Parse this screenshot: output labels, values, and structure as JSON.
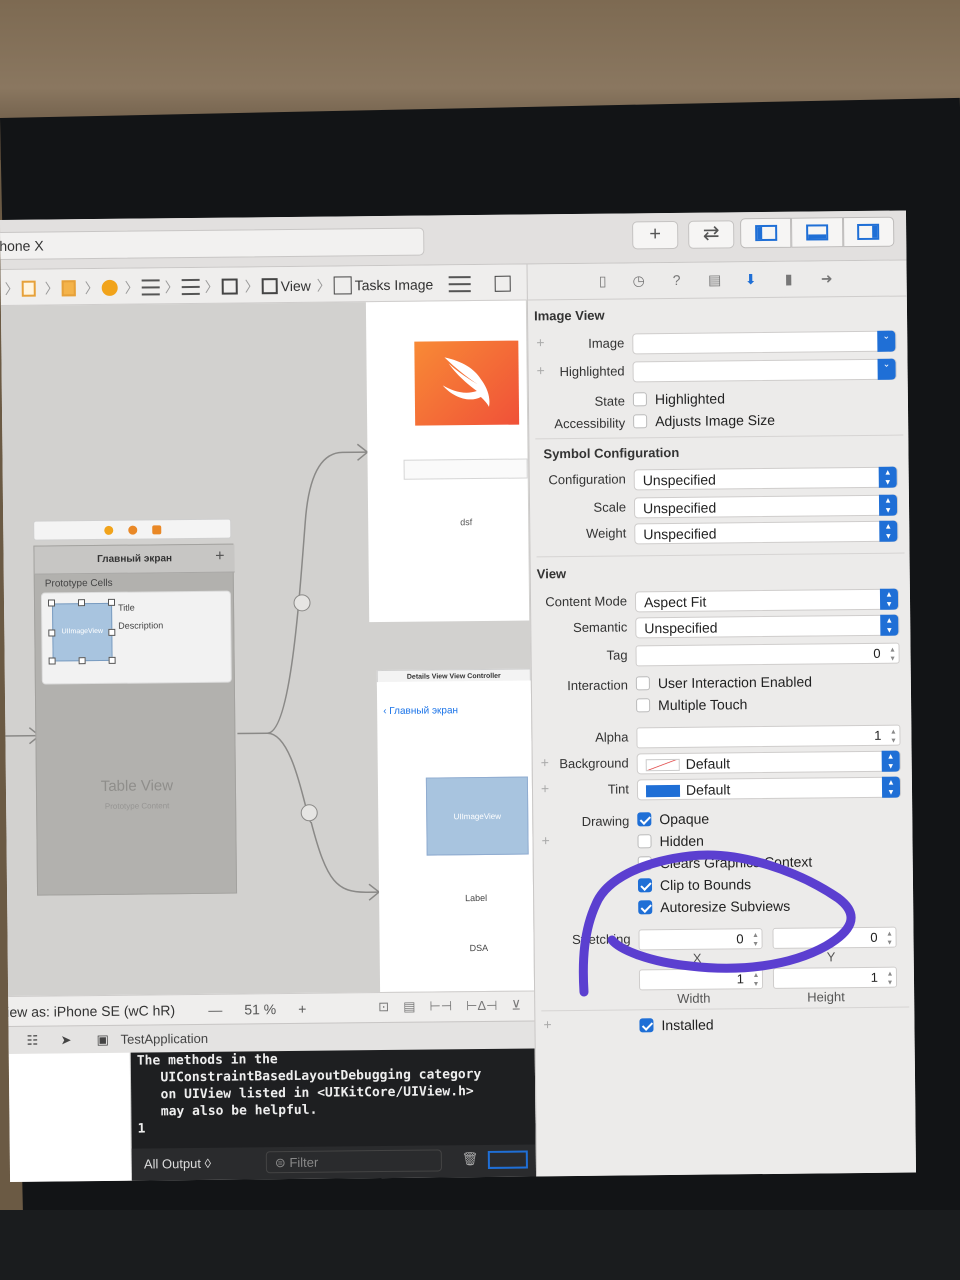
{
  "toolbar": {
    "scheme": "hone X",
    "add_label": "+",
    "swap_label": "⇄"
  },
  "jumpbar": {
    "view_label": "View",
    "tasks_image_label": "Tasks Image"
  },
  "canvas": {
    "top_vc_text": "dsf",
    "table_nav_title": "Главный экран",
    "prototype_cells": "Prototype Cells",
    "cell_image": "UIImageView",
    "cell_title": "Title",
    "cell_description": "Description",
    "table_view_title": "Table View",
    "table_view_sub": "Prototype Content",
    "detail_header": "Details View View Controller",
    "back_link": "Главный экран",
    "detail_image": "UIImageView",
    "detail_label": "Label",
    "detail_dsa": "DSA"
  },
  "canvas_bar": {
    "view_as": "iew as: iPhone SE (wC hR)",
    "minus": "—",
    "zoom": "51 %",
    "plus": "+"
  },
  "debug": {
    "target": "TestApplication",
    "console_lines": [
      "The methods in the",
      "   UIConstraintBasedLayoutDebugging category",
      "   on UIView listed in <UIKitCore/UIView.h>",
      "   may also be helpful.",
      "1"
    ],
    "output_select": "All Output ◊",
    "filter_placeholder": "Filter"
  },
  "inspector": {
    "image_view_header": "Image View",
    "image_label": "Image",
    "image_value": "",
    "highlighted_label": "Highlighted",
    "highlighted_value": "",
    "state_label": "State",
    "state_check": "Highlighted",
    "state_checked": false,
    "accessibility_label": "Accessibility",
    "accessibility_check": "Adjusts Image Size",
    "accessibility_checked": false,
    "symbol_header": "Symbol Configuration",
    "configuration_label": "Configuration",
    "configuration_value": "Unspecified",
    "scale_label": "Scale",
    "scale_value": "Unspecified",
    "weight_label": "Weight",
    "weight_value": "Unspecified",
    "view_header": "View",
    "content_mode_label": "Content Mode",
    "content_mode_value": "Aspect Fit",
    "semantic_label": "Semantic",
    "semantic_value": "Unspecified",
    "tag_label": "Tag",
    "tag_value": "0",
    "interaction_label": "Interaction",
    "user_interaction": "User Interaction Enabled",
    "multiple_touch": "Multiple Touch",
    "alpha_label": "Alpha",
    "alpha_value": "1",
    "background_label": "Background",
    "background_value": "Default",
    "tint_label": "Tint",
    "tint_value": "Default",
    "tint_color": "#1f6fd6",
    "drawing_label": "Drawing",
    "opaque": "Opaque",
    "hidden": "Hidden",
    "clears_graphics": "Clears Graphics Context",
    "clip_to_bounds": "Clip to Bounds",
    "autoresize": "Autoresize Subviews",
    "stretching_label": "Stretching",
    "stretch_x": "0",
    "stretch_y": "0",
    "stretch_w": "1",
    "stretch_h": "1",
    "x_label": "X",
    "y_label": "Y",
    "width_label": "Width",
    "height_label": "Height",
    "installed": "Installed"
  },
  "colors": {
    "accent": "#1f6fd6",
    "swift_orange": "#f05138",
    "annotation": "#5b3fd0"
  }
}
